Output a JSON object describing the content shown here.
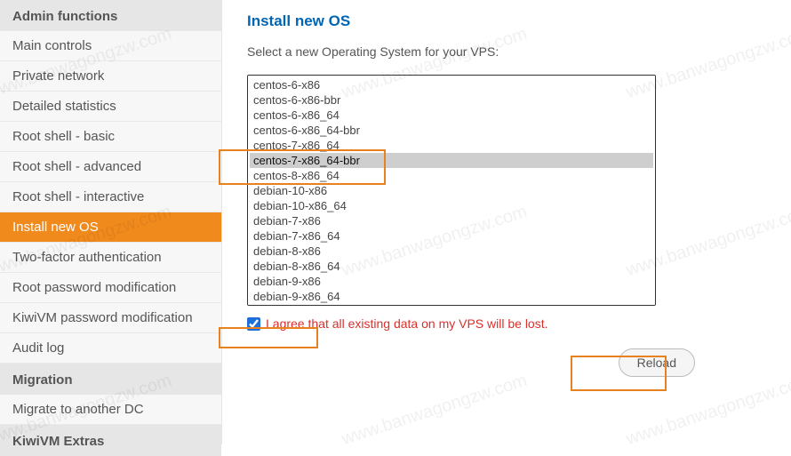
{
  "sidebar": {
    "sections": [
      {
        "header": "Admin functions",
        "items": [
          {
            "label": "Main controls"
          },
          {
            "label": "Private network"
          },
          {
            "label": "Detailed statistics"
          },
          {
            "label": "Root shell - basic"
          },
          {
            "label": "Root shell - advanced"
          },
          {
            "label": "Root shell - interactive"
          },
          {
            "label": "Install new OS",
            "active": true
          },
          {
            "label": "Two-factor authentication"
          },
          {
            "label": "Root password modification"
          },
          {
            "label": "KiwiVM password modification"
          },
          {
            "label": "Audit log"
          }
        ]
      },
      {
        "header": "Migration",
        "items": [
          {
            "label": "Migrate to another DC"
          }
        ]
      },
      {
        "header": "KiwiVM Extras",
        "items": []
      }
    ]
  },
  "main": {
    "title": "Install new OS",
    "instruction": "Select a new Operating System for your VPS:",
    "os_options": [
      "centos-6-x86",
      "centos-6-x86-bbr",
      "centos-6-x86_64",
      "centos-6-x86_64-bbr",
      "centos-7-x86_64",
      "centos-7-x86_64-bbr",
      "centos-8-x86_64",
      "debian-10-x86",
      "debian-10-x86_64",
      "debian-7-x86",
      "debian-7-x86_64",
      "debian-8-x86",
      "debian-8-x86_64",
      "debian-9-x86",
      "debian-9-x86_64"
    ],
    "os_selected": "centos-7-x86_64-bbr",
    "agree_checked": true,
    "agree_label": "I agree that all existing data on my VPS will be lost.",
    "reload_label": "Reload"
  },
  "watermark_text": "www.banwagongzw.com"
}
